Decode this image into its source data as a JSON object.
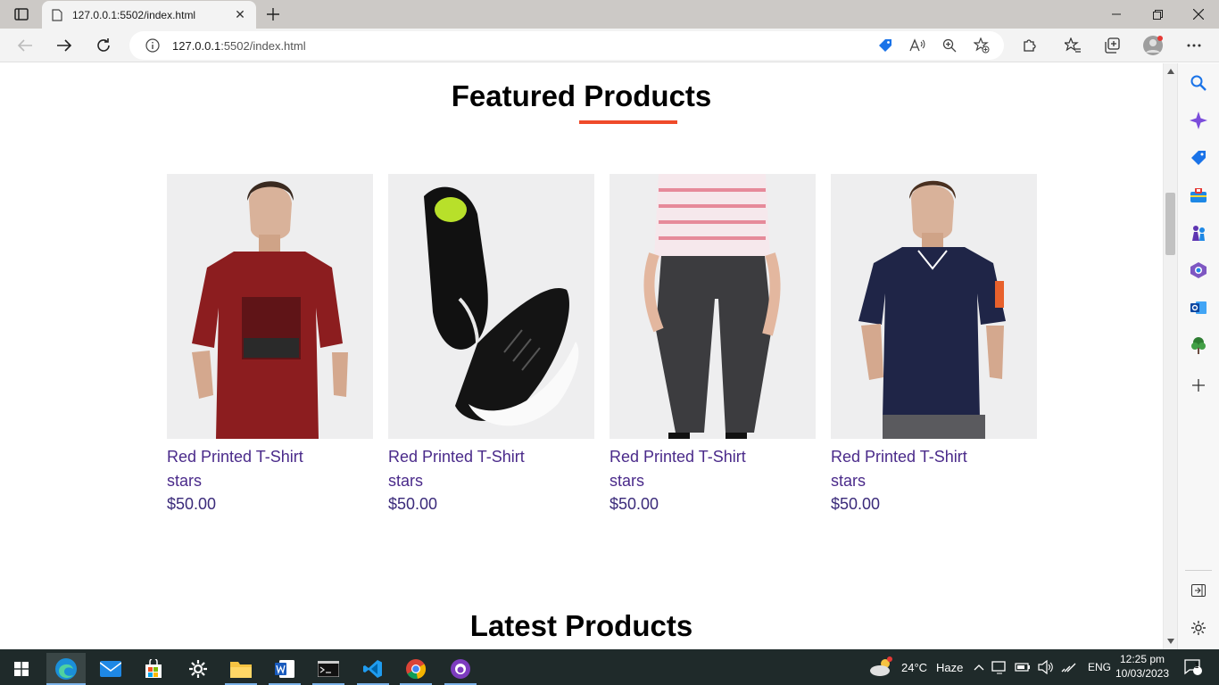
{
  "browser": {
    "tab_title": "127.0.0.1:5502/index.html",
    "url_host": "127.0.0.1",
    "url_rest": ":5502/index.html"
  },
  "page": {
    "featured_title": "Featured Products",
    "latest_title": "Latest Products",
    "accent_color": "#ef4a2a",
    "products": [
      {
        "name": "Red Printed T-Shirt",
        "rating": "stars",
        "price": "$50.00",
        "image": "man-red-t-shirt"
      },
      {
        "name": "Red Printed T-Shirt",
        "rating": "stars",
        "price": "$50.00",
        "image": "black-sneakers"
      },
      {
        "name": "Red Printed T-Shirt",
        "rating": "stars",
        "price": "$50.00",
        "image": "grey-track-pants"
      },
      {
        "name": "Red Printed T-Shirt",
        "rating": "stars",
        "price": "$50.00",
        "image": "man-navy-polo"
      }
    ]
  },
  "taskbar": {
    "weather_temp": "24°C",
    "weather_desc": "Haze",
    "language": "ENG",
    "time": "12:25 pm",
    "date": "10/03/2023",
    "notification_count": "1"
  }
}
